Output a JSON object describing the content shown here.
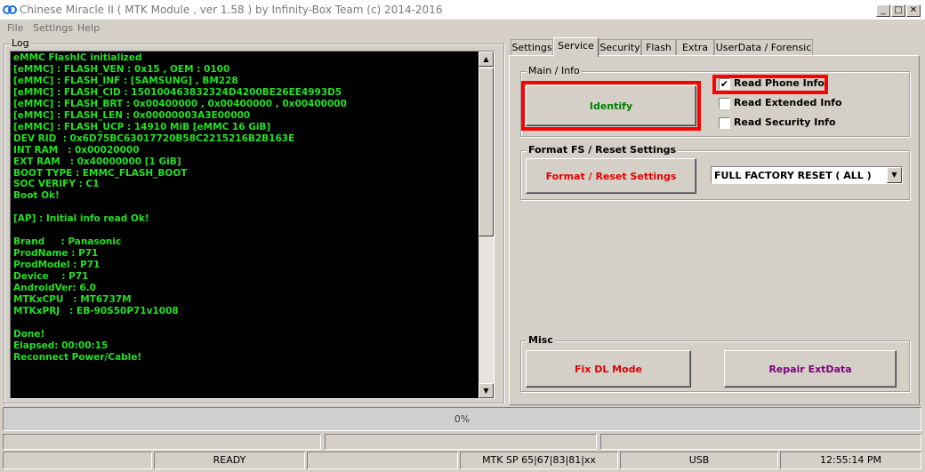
{
  "window": {
    "title": "Chinese Miracle II ( MTK Module , ver 1.58 ) by Infinity-Box Team (c) 2014-2016",
    "controls": {
      "minimize": "_",
      "maximize": "□",
      "close": "✕"
    }
  },
  "menu": [
    "File",
    "Settings",
    "Help"
  ],
  "log": {
    "label": "Log",
    "lines": [
      "eMMC FlashIC initialized",
      "[eMMC] : FLASH_VEN : 0x15 , OEM : 0100",
      "[eMMC] : FLASH_INF : [SAMSUNG] , BM228",
      "[eMMC] : FLASH_CID : 150100463832324D4200BE26EE4993D5",
      "[eMMC] : FLASH_BRT : 0x00400000 , 0x00400000 , 0x00400000",
      "[eMMC] : FLASH_LEN : 0x00000003A3E00000",
      "[eMMC] : FLASH_UCP : 14910 MiB [eMMC 16 GiB]",
      "DEV RID  : 0x6D75BC63017720B58C2215216B2B163E",
      "INT RAM   : 0x00020000",
      "EXT RAM   : 0x40000000 [1 GiB]",
      "BOOT TYPE : EMMC_FLASH_BOOT",
      "SOC VERIFY : C1",
      "Boot Ok!",
      "",
      "[AP] : Initial info read Ok!",
      "",
      "Brand     : Panasonic",
      "ProdName : P71",
      "ProdModel : P71",
      "Device    : P71",
      "AndroidVer: 6.0",
      "MTKxCPU   : MT6737M",
      "MTKxPRJ   : EB-90S50P71v1008",
      "",
      "Done!",
      "Elapsed: 00:00:15",
      "Reconnect Power/Cable!"
    ]
  },
  "tabs": [
    "Settings",
    "Service",
    "Security",
    "Flash",
    "Extra",
    "UserData / Forensic"
  ],
  "active_tab": "Service",
  "main_info": {
    "title": "Main / Info",
    "identify_label": "Identify",
    "options": [
      {
        "label": "Read Phone Info",
        "checked": true
      },
      {
        "label": "Read Extended Info",
        "checked": false
      },
      {
        "label": "Read Security Info",
        "checked": false
      }
    ]
  },
  "format": {
    "title": "Format FS / Reset Settings",
    "button_label": "Format / Reset Settings",
    "selected_option": "FULL FACTORY RESET ( ALL )"
  },
  "misc": {
    "title": "Misc",
    "fix_dl_label": "Fix DL Mode",
    "repair_label": "Repair ExtData"
  },
  "progress": {
    "value_percent": 0,
    "text": "0%"
  },
  "status": {
    "state": "READY",
    "protocol": "MTK SP 65|67|83|81|xx",
    "connection": "USB",
    "time": "12:55:14 PM"
  },
  "colors": {
    "log_text": "#22e022",
    "identify_text": "#008000",
    "format_text": "#e00000",
    "fix_dl_text": "#e00000",
    "repair_text": "#800080",
    "highlight": "#ff0000"
  }
}
